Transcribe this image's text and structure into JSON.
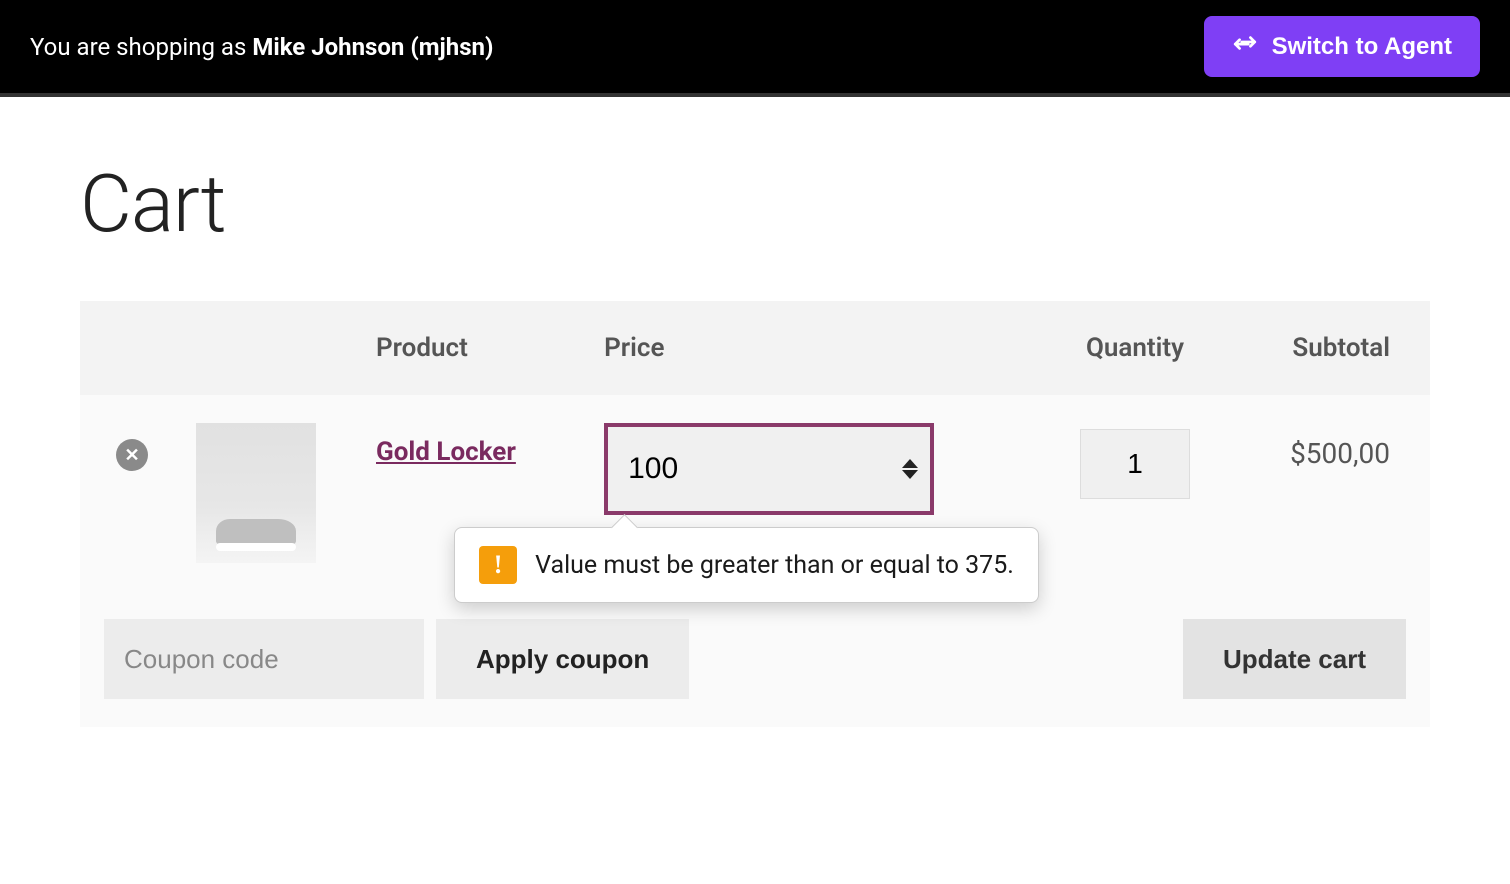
{
  "topbar": {
    "prefix": "You are shopping as ",
    "user": "Mike Johnson (mjhsn)",
    "switch_label": "Switch to Agent"
  },
  "page": {
    "title": "Cart"
  },
  "cart": {
    "headers": {
      "product": "Product",
      "price": "Price",
      "quantity": "Quantity",
      "subtotal": "Subtotal"
    },
    "item": {
      "name": "Gold Locker",
      "price_value": "100",
      "quantity_value": "1",
      "subtotal": "$500,00"
    },
    "validation_message": "Value must be greater than or equal to 375.",
    "coupon_placeholder": "Coupon code",
    "apply_label": "Apply coupon",
    "update_label": "Update cart"
  }
}
